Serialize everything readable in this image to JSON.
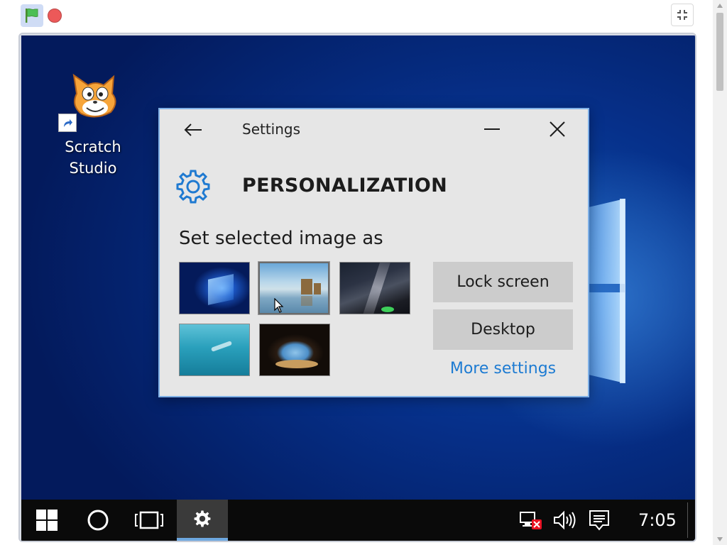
{
  "player": {
    "green_flag_icon": "green-flag-icon",
    "stop_icon": "stop-sign-icon",
    "fullscreen_icon": "exit-fullscreen-icon"
  },
  "desktop": {
    "shortcut": {
      "label_line1": "Scratch",
      "label_line2": "Studio",
      "icon": "scratch-cat-icon"
    }
  },
  "settings_window": {
    "title": "Settings",
    "page_title": "PERSONALIZATION",
    "subheading": "Set selected image as",
    "thumbnails": [
      {
        "name": "Windows 10 hero wallpaper",
        "selected": false
      },
      {
        "name": "Rock formations reflected on a lake",
        "selected": true
      },
      {
        "name": "Milky way night sky",
        "selected": false
      },
      {
        "name": "Underwater swimmer",
        "selected": false
      },
      {
        "name": "Sea cave view",
        "selected": false
      }
    ],
    "buttons": {
      "lock_screen": "Lock screen",
      "desktop": "Desktop"
    },
    "link": "More settings"
  },
  "taskbar": {
    "clock": "7:05",
    "active_item": "settings",
    "icons": [
      "windows-start-icon",
      "search-circle-icon",
      "task-view-icon",
      "settings-gear-icon",
      "network-disconnected-icon",
      "volume-icon",
      "action-center-icon"
    ]
  },
  "colors": {
    "link": "#1d7bd2",
    "window_border": "#7fb0e6",
    "taskbar_active_underline": "#6ea8e0"
  }
}
